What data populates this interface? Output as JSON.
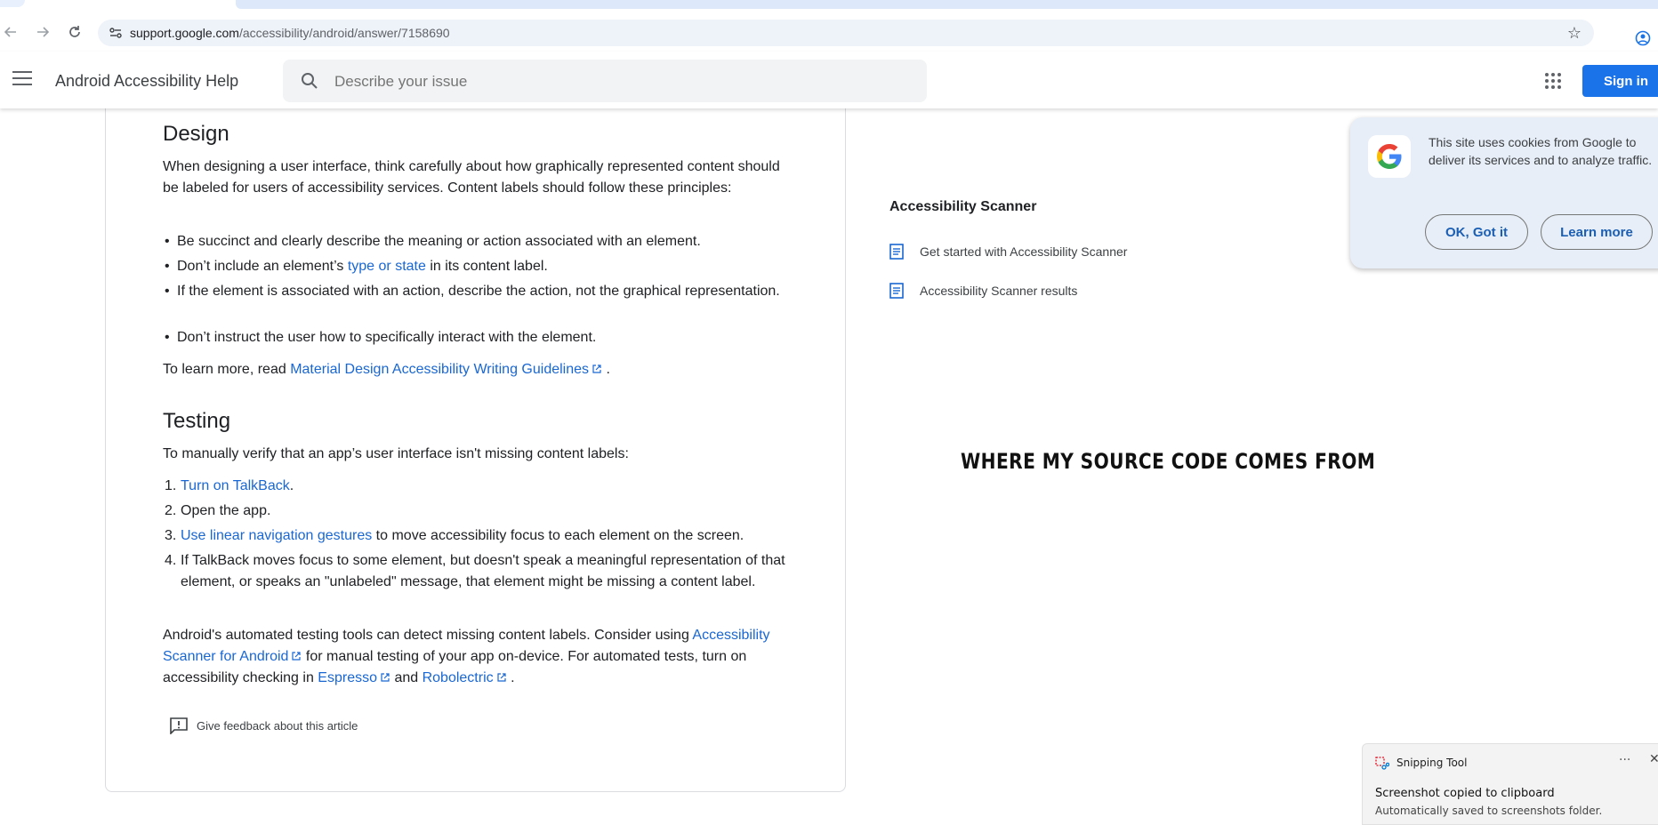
{
  "browser": {
    "url_host": "support.google.com",
    "url_path": "/accessibility/android/answer/7158690"
  },
  "header": {
    "title": "Android Accessibility Help",
    "search_placeholder": "Describe your issue",
    "signin_label": "Sign in"
  },
  "article": {
    "design_heading": "Design",
    "design_intro": "When designing a user interface, think carefully about how graphically represented content should be labeled for users of accessibility services. Content labels should follow these principles:",
    "bullets": [
      "Be succinct and clearly describe the meaning or action associated with an element.",
      "If the element is associated with an action, describe the action, not the graphical representation.",
      "Don’t instruct the user how to specifically interact with the element."
    ],
    "bullet2_pre": "Don’t include an element’s ",
    "bullet2_link": "type or state",
    "bullet2_post": " in its content label.",
    "learn_more_pre": "To learn more, read ",
    "learn_more_link": "Material Design Accessibility Writing Guidelines",
    "learn_more_post": ".",
    "testing_heading": "Testing",
    "testing_intro": "To manually verify that an app’s user interface isn't missing content labels:",
    "steps": {
      "s1_link": "Turn on TalkBack",
      "s1_post": ".",
      "s2": "Open the app.",
      "s3_link": "Use linear navigation gestures",
      "s3_post": " to move accessibility focus to each element on the screen.",
      "s4": "If TalkBack moves focus to some element, but doesn't speak a meaningful representation of that element, or speaks an \"unlabeled\" message, that element might be missing a content label."
    },
    "auto_pre": "Android's automated testing tools can detect missing content labels. Consider using ",
    "auto_link1": "Accessibility Scanner for Android",
    "auto_mid": " for manual testing of your app on-device. For automated tests, turn on accessibility checking in ",
    "auto_link2": "Espresso",
    "auto_and": " and ",
    "auto_link3": "Robolectric",
    "auto_end": ".",
    "feedback": "Give feedback about this article"
  },
  "sidebar": {
    "title": "Accessibility Scanner",
    "items": [
      "Get started with Accessibility Scanner",
      "Accessibility Scanner results"
    ]
  },
  "overlay_caption": "WHERE MY SOURCE CODE COMES FROM",
  "cookie": {
    "text": "This site uses cookies from Google to deliver its services and to analyze traffic.",
    "ok": "OK, Got it",
    "learn": "Learn more"
  },
  "snip": {
    "app": "Snipping Tool",
    "more": "···",
    "close": "✕",
    "main": "Screenshot copied to clipboard",
    "sub": "Automatically saved to screenshots folder."
  }
}
